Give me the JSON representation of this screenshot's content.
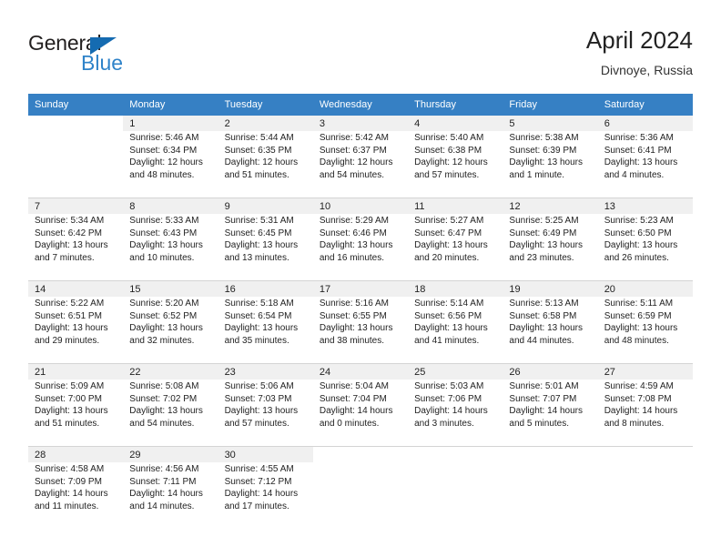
{
  "brand": {
    "name_part1": "General",
    "name_part2": "Blue",
    "triangle_color": "#156bb1",
    "blue_color": "#2f83c9"
  },
  "header": {
    "title": "April 2024",
    "subtitle": "Divnoye, Russia",
    "header_bg_color": "#3680c4"
  },
  "weekdays": [
    "Sunday",
    "Monday",
    "Tuesday",
    "Wednesday",
    "Thursday",
    "Friday",
    "Saturday"
  ],
  "weeks": [
    [
      {
        "day": "",
        "sunrise": "",
        "sunset": "",
        "daylight1": "",
        "daylight2": ""
      },
      {
        "day": "1",
        "sunrise": "Sunrise: 5:46 AM",
        "sunset": "Sunset: 6:34 PM",
        "daylight1": "Daylight: 12 hours",
        "daylight2": "and 48 minutes."
      },
      {
        "day": "2",
        "sunrise": "Sunrise: 5:44 AM",
        "sunset": "Sunset: 6:35 PM",
        "daylight1": "Daylight: 12 hours",
        "daylight2": "and 51 minutes."
      },
      {
        "day": "3",
        "sunrise": "Sunrise: 5:42 AM",
        "sunset": "Sunset: 6:37 PM",
        "daylight1": "Daylight: 12 hours",
        "daylight2": "and 54 minutes."
      },
      {
        "day": "4",
        "sunrise": "Sunrise: 5:40 AM",
        "sunset": "Sunset: 6:38 PM",
        "daylight1": "Daylight: 12 hours",
        "daylight2": "and 57 minutes."
      },
      {
        "day": "5",
        "sunrise": "Sunrise: 5:38 AM",
        "sunset": "Sunset: 6:39 PM",
        "daylight1": "Daylight: 13 hours",
        "daylight2": "and 1 minute."
      },
      {
        "day": "6",
        "sunrise": "Sunrise: 5:36 AM",
        "sunset": "Sunset: 6:41 PM",
        "daylight1": "Daylight: 13 hours",
        "daylight2": "and 4 minutes."
      }
    ],
    [
      {
        "day": "7",
        "sunrise": "Sunrise: 5:34 AM",
        "sunset": "Sunset: 6:42 PM",
        "daylight1": "Daylight: 13 hours",
        "daylight2": "and 7 minutes."
      },
      {
        "day": "8",
        "sunrise": "Sunrise: 5:33 AM",
        "sunset": "Sunset: 6:43 PM",
        "daylight1": "Daylight: 13 hours",
        "daylight2": "and 10 minutes."
      },
      {
        "day": "9",
        "sunrise": "Sunrise: 5:31 AM",
        "sunset": "Sunset: 6:45 PM",
        "daylight1": "Daylight: 13 hours",
        "daylight2": "and 13 minutes."
      },
      {
        "day": "10",
        "sunrise": "Sunrise: 5:29 AM",
        "sunset": "Sunset: 6:46 PM",
        "daylight1": "Daylight: 13 hours",
        "daylight2": "and 16 minutes."
      },
      {
        "day": "11",
        "sunrise": "Sunrise: 5:27 AM",
        "sunset": "Sunset: 6:47 PM",
        "daylight1": "Daylight: 13 hours",
        "daylight2": "and 20 minutes."
      },
      {
        "day": "12",
        "sunrise": "Sunrise: 5:25 AM",
        "sunset": "Sunset: 6:49 PM",
        "daylight1": "Daylight: 13 hours",
        "daylight2": "and 23 minutes."
      },
      {
        "day": "13",
        "sunrise": "Sunrise: 5:23 AM",
        "sunset": "Sunset: 6:50 PM",
        "daylight1": "Daylight: 13 hours",
        "daylight2": "and 26 minutes."
      }
    ],
    [
      {
        "day": "14",
        "sunrise": "Sunrise: 5:22 AM",
        "sunset": "Sunset: 6:51 PM",
        "daylight1": "Daylight: 13 hours",
        "daylight2": "and 29 minutes."
      },
      {
        "day": "15",
        "sunrise": "Sunrise: 5:20 AM",
        "sunset": "Sunset: 6:52 PM",
        "daylight1": "Daylight: 13 hours",
        "daylight2": "and 32 minutes."
      },
      {
        "day": "16",
        "sunrise": "Sunrise: 5:18 AM",
        "sunset": "Sunset: 6:54 PM",
        "daylight1": "Daylight: 13 hours",
        "daylight2": "and 35 minutes."
      },
      {
        "day": "17",
        "sunrise": "Sunrise: 5:16 AM",
        "sunset": "Sunset: 6:55 PM",
        "daylight1": "Daylight: 13 hours",
        "daylight2": "and 38 minutes."
      },
      {
        "day": "18",
        "sunrise": "Sunrise: 5:14 AM",
        "sunset": "Sunset: 6:56 PM",
        "daylight1": "Daylight: 13 hours",
        "daylight2": "and 41 minutes."
      },
      {
        "day": "19",
        "sunrise": "Sunrise: 5:13 AM",
        "sunset": "Sunset: 6:58 PM",
        "daylight1": "Daylight: 13 hours",
        "daylight2": "and 44 minutes."
      },
      {
        "day": "20",
        "sunrise": "Sunrise: 5:11 AM",
        "sunset": "Sunset: 6:59 PM",
        "daylight1": "Daylight: 13 hours",
        "daylight2": "and 48 minutes."
      }
    ],
    [
      {
        "day": "21",
        "sunrise": "Sunrise: 5:09 AM",
        "sunset": "Sunset: 7:00 PM",
        "daylight1": "Daylight: 13 hours",
        "daylight2": "and 51 minutes."
      },
      {
        "day": "22",
        "sunrise": "Sunrise: 5:08 AM",
        "sunset": "Sunset: 7:02 PM",
        "daylight1": "Daylight: 13 hours",
        "daylight2": "and 54 minutes."
      },
      {
        "day": "23",
        "sunrise": "Sunrise: 5:06 AM",
        "sunset": "Sunset: 7:03 PM",
        "daylight1": "Daylight: 13 hours",
        "daylight2": "and 57 minutes."
      },
      {
        "day": "24",
        "sunrise": "Sunrise: 5:04 AM",
        "sunset": "Sunset: 7:04 PM",
        "daylight1": "Daylight: 14 hours",
        "daylight2": "and 0 minutes."
      },
      {
        "day": "25",
        "sunrise": "Sunrise: 5:03 AM",
        "sunset": "Sunset: 7:06 PM",
        "daylight1": "Daylight: 14 hours",
        "daylight2": "and 3 minutes."
      },
      {
        "day": "26",
        "sunrise": "Sunrise: 5:01 AM",
        "sunset": "Sunset: 7:07 PM",
        "daylight1": "Daylight: 14 hours",
        "daylight2": "and 5 minutes."
      },
      {
        "day": "27",
        "sunrise": "Sunrise: 4:59 AM",
        "sunset": "Sunset: 7:08 PM",
        "daylight1": "Daylight: 14 hours",
        "daylight2": "and 8 minutes."
      }
    ],
    [
      {
        "day": "28",
        "sunrise": "Sunrise: 4:58 AM",
        "sunset": "Sunset: 7:09 PM",
        "daylight1": "Daylight: 14 hours",
        "daylight2": "and 11 minutes."
      },
      {
        "day": "29",
        "sunrise": "Sunrise: 4:56 AM",
        "sunset": "Sunset: 7:11 PM",
        "daylight1": "Daylight: 14 hours",
        "daylight2": "and 14 minutes."
      },
      {
        "day": "30",
        "sunrise": "Sunrise: 4:55 AM",
        "sunset": "Sunset: 7:12 PM",
        "daylight1": "Daylight: 14 hours",
        "daylight2": "and 17 minutes."
      },
      {
        "day": "",
        "sunrise": "",
        "sunset": "",
        "daylight1": "",
        "daylight2": ""
      },
      {
        "day": "",
        "sunrise": "",
        "sunset": "",
        "daylight1": "",
        "daylight2": ""
      },
      {
        "day": "",
        "sunrise": "",
        "sunset": "",
        "daylight1": "",
        "daylight2": ""
      },
      {
        "day": "",
        "sunrise": "",
        "sunset": "",
        "daylight1": "",
        "daylight2": ""
      }
    ]
  ]
}
